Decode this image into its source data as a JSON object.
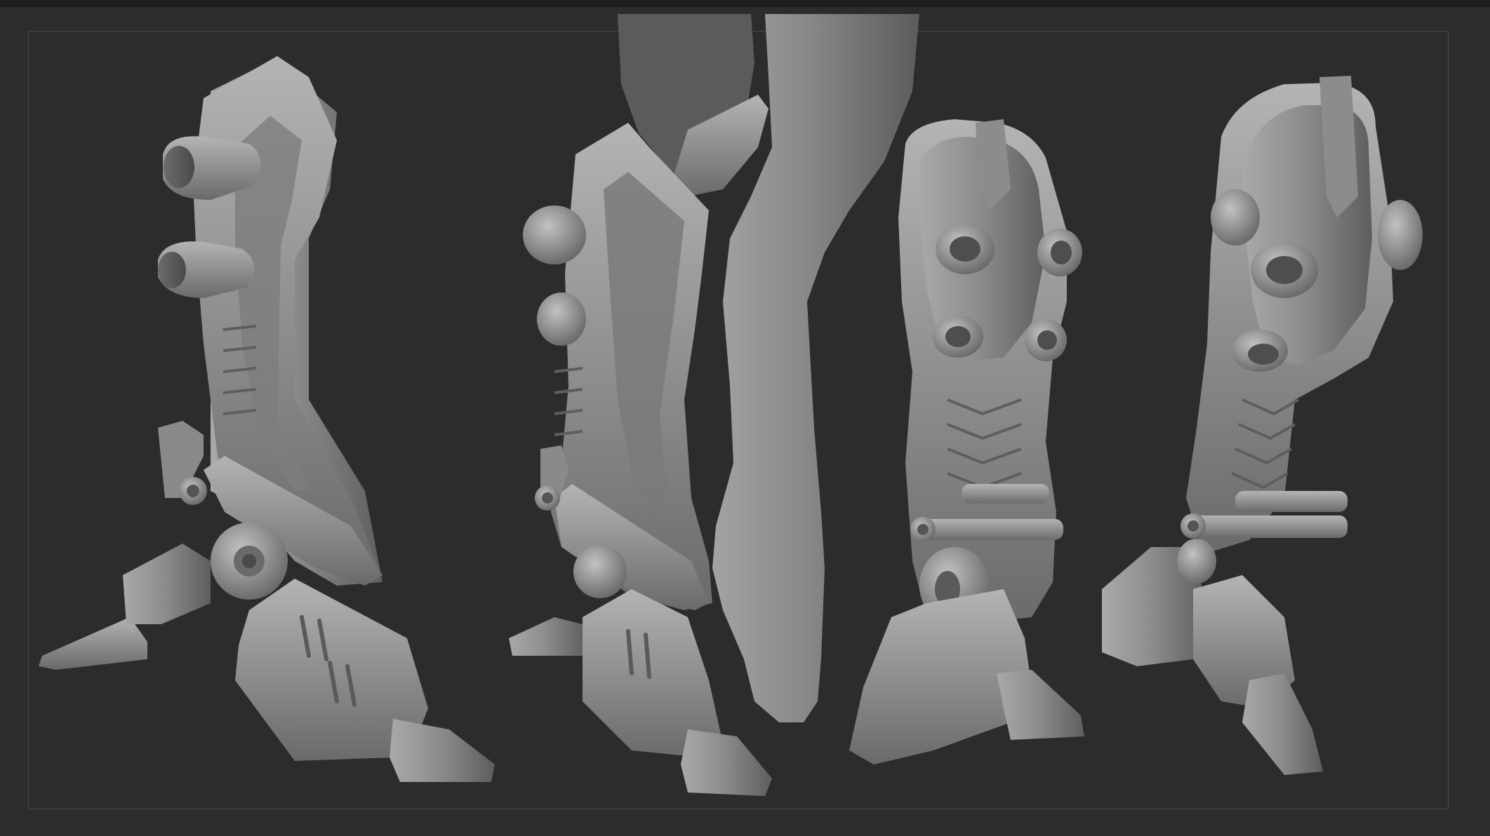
{
  "viewport": {
    "background_color": "#2c2c2c",
    "frame_color": "#4a4a4a",
    "clay_color": "#8c8c8c"
  },
  "scene": {
    "subjects": [
      {
        "name": "armored-leg-side-view"
      },
      {
        "name": "armored-leg-three-quarter-with-body"
      },
      {
        "name": "armored-leg-front-view"
      },
      {
        "name": "armored-leg-front-three-quarter-view"
      }
    ]
  }
}
